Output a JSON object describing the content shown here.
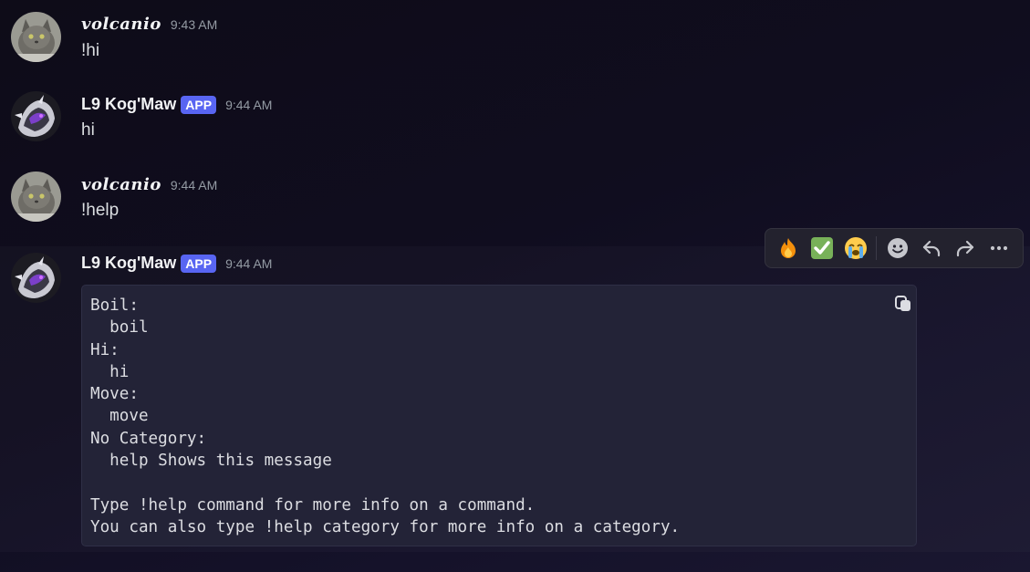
{
  "messages": [
    {
      "username": "volcanio",
      "badge": "",
      "timestamp": "9:43 AM",
      "text": "!hi"
    },
    {
      "username": "L9 Kog'Maw",
      "badge": "APP",
      "timestamp": "9:44 AM",
      "text": "hi"
    },
    {
      "username": "volcanio",
      "badge": "",
      "timestamp": "9:44 AM",
      "text": "!help"
    },
    {
      "username": "L9 Kog'Maw",
      "badge": "APP",
      "timestamp": "9:44 AM",
      "code": "Boil:\n  boil\nHi:\n  hi\nMove:\n  move\nNo Category:\n  help Shows this message\n\nType !help command for more info on a command.\nYou can also type !help category for more info on a category."
    }
  ],
  "toolbar": {
    "reactions": [
      "🔥",
      "✅",
      "😭"
    ],
    "icons": [
      "add-reaction-icon",
      "reply-icon",
      "forward-icon",
      "more-icon"
    ]
  },
  "colors": {
    "badge": "#5865f2",
    "timestamp": "#949ba4",
    "code_background": "#232337"
  }
}
